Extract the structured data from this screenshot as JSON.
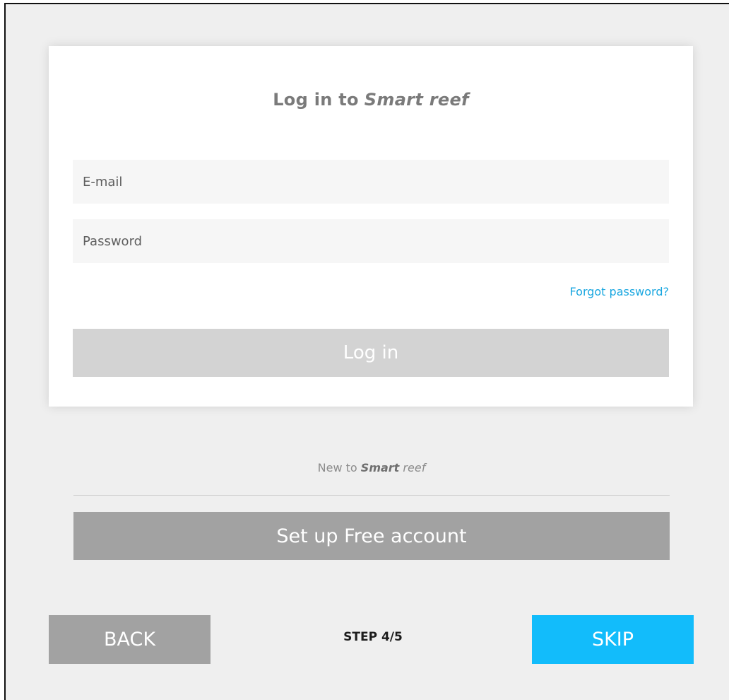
{
  "login_card": {
    "title_prefix": "Log in to",
    "title_brand": "Smart reef",
    "email": {
      "value": "",
      "placeholder": "E-mail"
    },
    "password": {
      "value": "",
      "placeholder": "Password"
    },
    "forgot_password_label": "Forgot password?",
    "login_button_label": "Log in"
  },
  "signup": {
    "prompt_prefix": "New to",
    "brand_bold": "Smart",
    "brand_italic": "reef",
    "button_label": "Set up Free account"
  },
  "footer": {
    "back_label": "BACK",
    "step_label": "STEP 4/5",
    "skip_label": "SKIP"
  },
  "colors": {
    "background": "#efefef",
    "link": "#1aa7e0",
    "skip_accent": "#12bcfb",
    "disabled_button": "#d3d3d3",
    "secondary_button": "#a2a2a2"
  }
}
